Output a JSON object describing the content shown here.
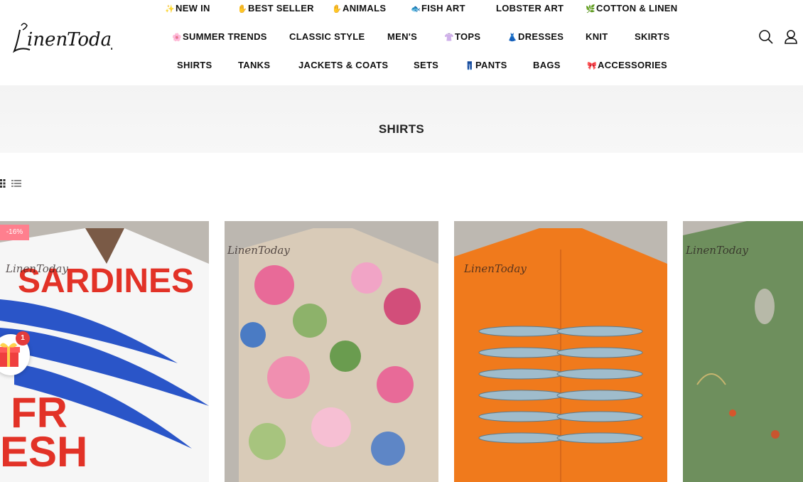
{
  "brand": {
    "logo_text": "LinenToday"
  },
  "nav": {
    "row1": [
      {
        "emoji": "✨",
        "label": "NEW IN"
      },
      {
        "emoji": "✋",
        "label": "BEST SELLER"
      },
      {
        "emoji": "✋",
        "label": "ANIMALS"
      },
      {
        "emoji": "🐟",
        "label": "FISH ART"
      },
      {
        "emoji": "",
        "label": "LOBSTER ART"
      },
      {
        "emoji": "🌿",
        "label": "COTTON & LINEN"
      }
    ],
    "row2": [
      {
        "emoji": "🌸",
        "label": "SUMMER TRENDS"
      },
      {
        "emoji": "",
        "label": "CLASSIC STYLE"
      },
      {
        "emoji": "",
        "label": "MEN'S"
      },
      {
        "emoji": "👚",
        "label": "TOPS"
      },
      {
        "emoji": "👗",
        "label": "DRESSES"
      },
      {
        "emoji": "",
        "label": "KNIT"
      },
      {
        "emoji": "",
        "label": "SKIRTS"
      }
    ],
    "row3": [
      {
        "emoji": "",
        "label": "SHIRTS"
      },
      {
        "emoji": "",
        "label": "TANKS"
      },
      {
        "emoji": "",
        "label": "JACKETS & COATS"
      },
      {
        "emoji": "",
        "label": "SETS"
      },
      {
        "emoji": "👖",
        "label": "PANTS"
      },
      {
        "emoji": "",
        "label": "BAGS"
      },
      {
        "emoji": "🎀",
        "label": "ACCESSORIES"
      }
    ]
  },
  "header_icons": [
    "search-icon",
    "user-icon"
  ],
  "page": {
    "title": "SHIRTS"
  },
  "view_toggles": [
    "grid-view-icon",
    "list-view-icon"
  ],
  "products": [
    {
      "badge": "-16%",
      "watermark": "LinenToday",
      "color": "#ffffff",
      "accent": "#1f4fbf",
      "print": "SARDINES / FRESH"
    },
    {
      "badge": "",
      "watermark": "LinenToday",
      "color": "#d9c9b5",
      "accent": "#e05a8a",
      "print": "floral"
    },
    {
      "badge": "",
      "watermark": "LinenToday",
      "color": "#f07a1e",
      "accent": "#7aa3b8",
      "print": "fish"
    },
    {
      "badge": "",
      "watermark": "LinenToday",
      "color": "#6f8f5e",
      "accent": "#b7c2a2",
      "print": "rabbit"
    }
  ],
  "gift": {
    "count": "1"
  }
}
